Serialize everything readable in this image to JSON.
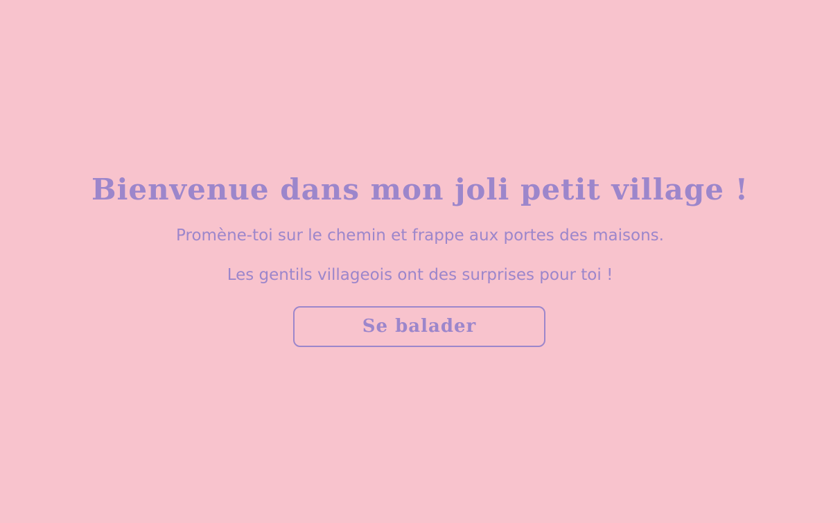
{
  "welcome": {
    "title": "Bienvenue dans mon joli petit village !",
    "line1": "Promène-toi sur le chemin et frappe aux portes des maisons.",
    "line2": "Les gentils villageois ont des surprises pour toi !",
    "button_label": "Se balader"
  },
  "colors": {
    "background": "#F8C3CD",
    "accent": "#9C86CB"
  }
}
